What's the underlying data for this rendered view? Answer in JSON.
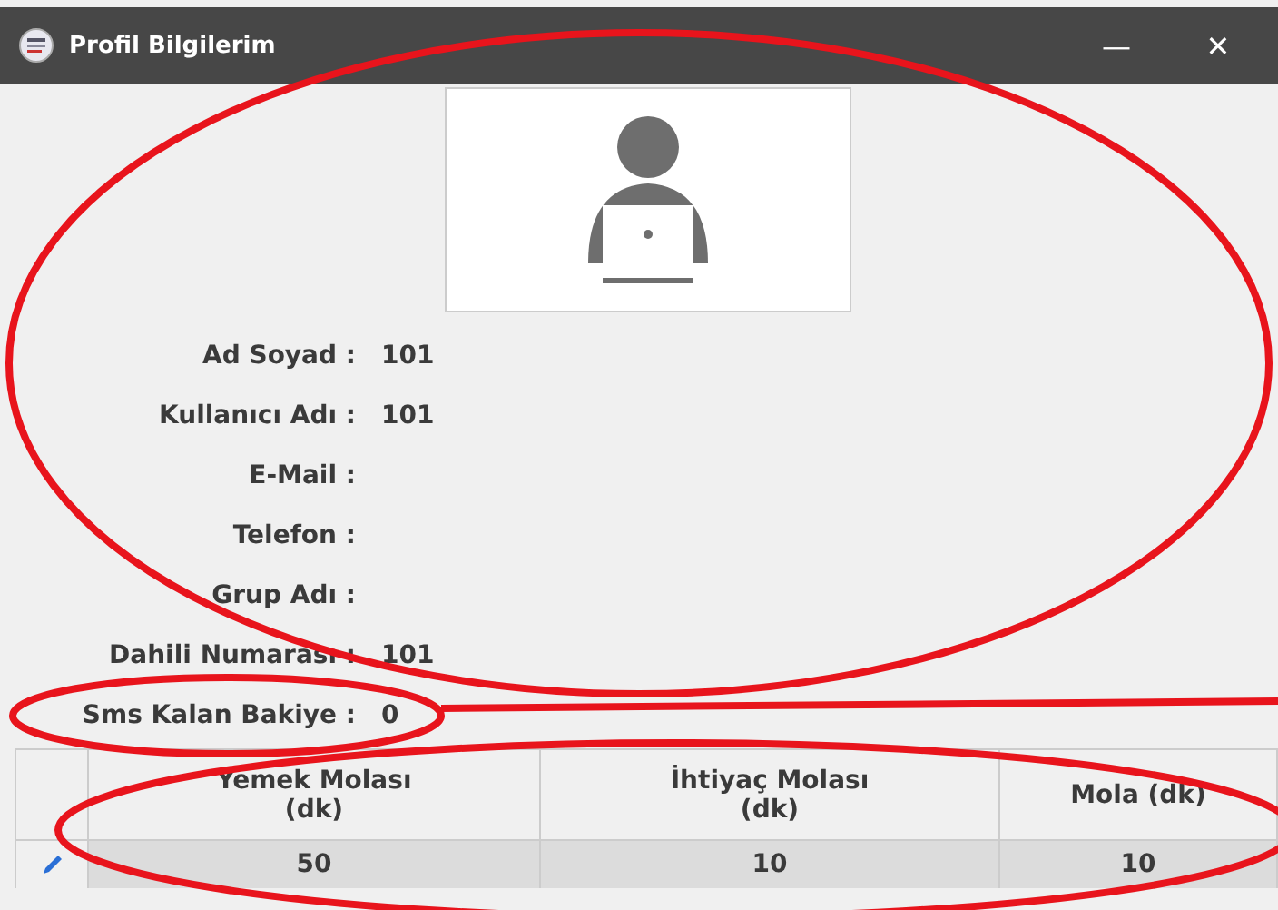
{
  "window": {
    "title": "Profil Bilgilerim",
    "buttons": [
      "—",
      "✕"
    ]
  },
  "profile_fields": [
    {
      "label": "Ad Soyad :",
      "value": "101"
    },
    {
      "label": "Kullanıcı Adı :",
      "value": "101"
    },
    {
      "label": "E-Mail :"
    },
    {
      "label": "Telefon :"
    },
    {
      "label": "Grup Adı :"
    },
    {
      "label": "Dahili Numarası :",
      "value": "101"
    },
    {
      "label": "Sms Kalan Bakiye :",
      "value": "0"
    }
  ],
  "table": {
    "columns": [
      "Yemek Molası (dk)",
      "İhtiyaç Molası (dk)",
      "Mola (dk)"
    ],
    "rows": [
      {
        "cells": [
          "50",
          "10",
          "10"
        ],
        "selected": true
      }
    ]
  }
}
